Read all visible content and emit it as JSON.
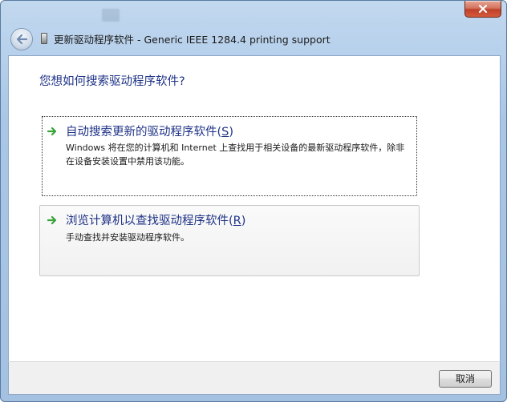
{
  "window": {
    "title": "更新驱动程序软件 - Generic IEEE 1284.4 printing support",
    "colors": {
      "glass": "#a9c6e6",
      "heading": "#1e3287",
      "arrow": "#3aa33a",
      "close": "#c0402a"
    }
  },
  "titlebar": {
    "close_icon": "close-icon",
    "back_icon": "back-arrow-icon",
    "device_icon": "device-icon"
  },
  "content": {
    "heading": "您想如何搜索驱动程序软件?",
    "options": [
      {
        "title": "自动搜索更新的驱动程序软件(",
        "accel": "S",
        "close": ")",
        "description": "Windows 将在您的计算机和 Internet 上查找用于相关设备的最新驱动程序软件，除非在设备安装设置中禁用该功能。",
        "icon": "green-arrow-icon"
      },
      {
        "title": "浏览计算机以查找驱动程序软件(",
        "accel": "R",
        "close": ")",
        "description": "手动查找并安装驱动程序软件。",
        "icon": "green-arrow-icon"
      }
    ]
  },
  "footer": {
    "cancel_label": "取消"
  }
}
